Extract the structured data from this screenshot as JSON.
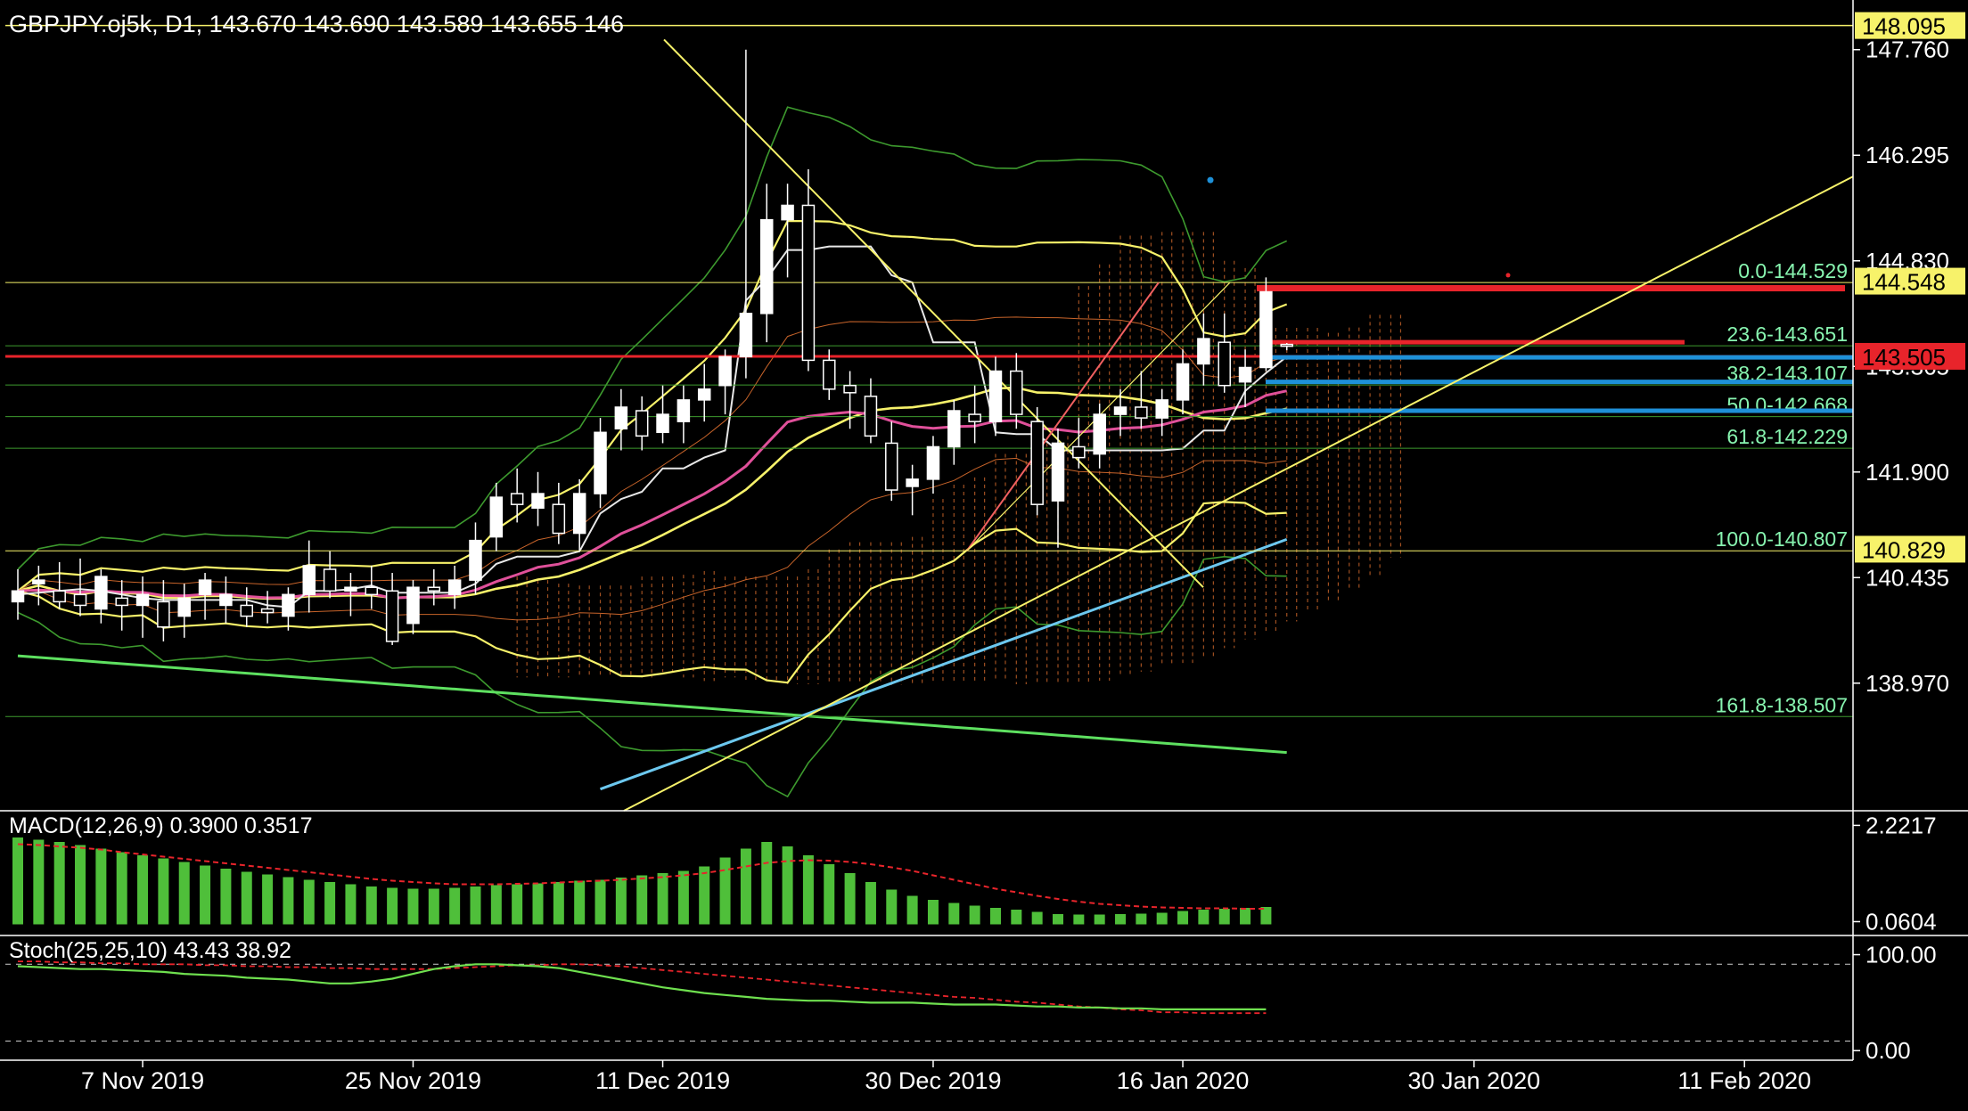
{
  "header": {
    "main_title": "GBPJPY.oj5k, D1, 143.670 143.690 143.589 143.655 146",
    "macd_title": "MACD(12,26,9) 0.3900 0.3517",
    "stoch_title": "Stoch(25,25,10) 43.43 38.92"
  },
  "colors": {
    "background": "#000000",
    "panel_border": "#ffffff",
    "candle": "#ffffff",
    "yellow": "#f7f26a",
    "red": "#e8242b",
    "blue": "#1e90d8",
    "fib_text": "#88f5b0",
    "macd_hist": "#4fbf3a",
    "macd_signal": "#e8242b",
    "stoch_main": "#6fe04f",
    "stoch_signal": "#e8242b",
    "ma_magenta": "#e0509a",
    "ma_green": "#5ee060",
    "ma_cyan": "#6cc8ef",
    "bb_green": "#3d9a2e",
    "ichimoku_cloud": "#c8642a"
  },
  "chart_data": [
    {
      "type": "candlestick",
      "symbol": "GBPJPY.oj5k",
      "timeframe": "D1",
      "ohlc_last": {
        "open": 143.67,
        "high": 143.69,
        "low": 143.589,
        "close": 143.655,
        "volume": 146
      },
      "y_ticks": [
        "147.760",
        "146.295",
        "144.830",
        "143.365",
        "141.900",
        "140.435",
        "138.970"
      ],
      "ylim": [
        137.2,
        148.35
      ],
      "x_ticks": [
        "7 Nov 2019",
        "25 Nov 2019",
        "11 Dec 2019",
        "30 Dec 2019",
        "16 Jan 2020",
        "30 Jan 2020",
        "11 Feb 2020"
      ],
      "x_tick_index": [
        6,
        19,
        31,
        44,
        56,
        70,
        83
      ],
      "candles": [
        {
          "o": 140.1,
          "h": 140.55,
          "l": 139.85,
          "c": 140.25
        },
        {
          "o": 140.35,
          "h": 140.6,
          "l": 140.05,
          "c": 140.4
        },
        {
          "o": 140.25,
          "h": 140.65,
          "l": 140.0,
          "c": 140.1
        },
        {
          "o": 140.2,
          "h": 140.7,
          "l": 139.9,
          "c": 140.05
        },
        {
          "o": 140.0,
          "h": 140.55,
          "l": 139.8,
          "c": 140.45
        },
        {
          "o": 140.15,
          "h": 140.4,
          "l": 139.7,
          "c": 140.05
        },
        {
          "o": 140.05,
          "h": 140.45,
          "l": 139.6,
          "c": 140.2
        },
        {
          "o": 140.1,
          "h": 140.4,
          "l": 139.55,
          "c": 139.75
        },
        {
          "o": 139.9,
          "h": 140.35,
          "l": 139.6,
          "c": 140.15
        },
        {
          "o": 140.2,
          "h": 140.5,
          "l": 139.85,
          "c": 140.4
        },
        {
          "o": 140.05,
          "h": 140.45,
          "l": 139.8,
          "c": 140.2
        },
        {
          "o": 140.05,
          "h": 140.3,
          "l": 139.75,
          "c": 139.9
        },
        {
          "o": 140.0,
          "h": 140.25,
          "l": 139.8,
          "c": 139.95
        },
        {
          "o": 139.9,
          "h": 140.3,
          "l": 139.7,
          "c": 140.2
        },
        {
          "o": 140.2,
          "h": 140.95,
          "l": 139.95,
          "c": 140.6
        },
        {
          "o": 140.55,
          "h": 140.8,
          "l": 140.15,
          "c": 140.25
        },
        {
          "o": 140.25,
          "h": 140.5,
          "l": 139.9,
          "c": 140.3
        },
        {
          "o": 140.3,
          "h": 140.6,
          "l": 140.0,
          "c": 140.2
        },
        {
          "o": 140.25,
          "h": 140.5,
          "l": 139.5,
          "c": 139.55
        },
        {
          "o": 139.8,
          "h": 140.4,
          "l": 139.65,
          "c": 140.3
        },
        {
          "o": 140.3,
          "h": 140.55,
          "l": 140.05,
          "c": 140.25
        },
        {
          "o": 140.2,
          "h": 140.6,
          "l": 140.0,
          "c": 140.4
        },
        {
          "o": 140.4,
          "h": 141.2,
          "l": 140.2,
          "c": 140.95
        },
        {
          "o": 141.0,
          "h": 141.75,
          "l": 140.8,
          "c": 141.55
        },
        {
          "o": 141.6,
          "h": 141.95,
          "l": 141.2,
          "c": 141.45
        },
        {
          "o": 141.4,
          "h": 141.9,
          "l": 141.15,
          "c": 141.6
        },
        {
          "o": 141.45,
          "h": 141.75,
          "l": 140.9,
          "c": 141.05
        },
        {
          "o": 141.05,
          "h": 141.8,
          "l": 140.8,
          "c": 141.6
        },
        {
          "o": 141.6,
          "h": 142.65,
          "l": 141.4,
          "c": 142.45
        },
        {
          "o": 142.5,
          "h": 143.05,
          "l": 142.2,
          "c": 142.8
        },
        {
          "o": 142.75,
          "h": 142.95,
          "l": 142.2,
          "c": 142.4
        },
        {
          "o": 142.45,
          "h": 143.1,
          "l": 142.3,
          "c": 142.7
        },
        {
          "o": 142.6,
          "h": 143.1,
          "l": 142.3,
          "c": 142.9
        },
        {
          "o": 142.9,
          "h": 143.4,
          "l": 142.6,
          "c": 143.05
        },
        {
          "o": 143.1,
          "h": 143.6,
          "l": 142.7,
          "c": 143.5
        },
        {
          "o": 143.5,
          "h": 147.76,
          "l": 143.2,
          "c": 144.1
        },
        {
          "o": 144.1,
          "h": 145.9,
          "l": 143.7,
          "c": 145.4
        },
        {
          "o": 145.4,
          "h": 145.9,
          "l": 144.6,
          "c": 145.6
        },
        {
          "o": 145.6,
          "h": 146.1,
          "l": 143.3,
          "c": 143.45
        },
        {
          "o": 143.45,
          "h": 143.6,
          "l": 142.9,
          "c": 143.05
        },
        {
          "o": 143.1,
          "h": 143.3,
          "l": 142.5,
          "c": 143.0
        },
        {
          "o": 142.95,
          "h": 143.2,
          "l": 142.3,
          "c": 142.4
        },
        {
          "o": 142.3,
          "h": 142.6,
          "l": 141.5,
          "c": 141.65
        },
        {
          "o": 141.7,
          "h": 142.0,
          "l": 141.3,
          "c": 141.8
        },
        {
          "o": 141.8,
          "h": 142.4,
          "l": 141.6,
          "c": 142.25
        },
        {
          "o": 142.25,
          "h": 142.9,
          "l": 142.0,
          "c": 142.75
        },
        {
          "o": 142.7,
          "h": 143.1,
          "l": 142.3,
          "c": 142.6
        },
        {
          "o": 142.6,
          "h": 143.5,
          "l": 142.4,
          "c": 143.3
        },
        {
          "o": 143.3,
          "h": 143.55,
          "l": 142.5,
          "c": 142.7
        },
        {
          "o": 142.6,
          "h": 142.8,
          "l": 141.3,
          "c": 141.45
        },
        {
          "o": 141.5,
          "h": 142.5,
          "l": 140.85,
          "c": 142.3
        },
        {
          "o": 142.25,
          "h": 142.65,
          "l": 141.95,
          "c": 142.1
        },
        {
          "o": 142.15,
          "h": 142.85,
          "l": 141.95,
          "c": 142.7
        },
        {
          "o": 142.7,
          "h": 143.05,
          "l": 142.4,
          "c": 142.8
        },
        {
          "o": 142.8,
          "h": 143.3,
          "l": 142.5,
          "c": 142.65
        },
        {
          "o": 142.65,
          "h": 143.05,
          "l": 142.4,
          "c": 142.9
        },
        {
          "o": 142.9,
          "h": 143.6,
          "l": 142.7,
          "c": 143.4
        },
        {
          "o": 143.4,
          "h": 144.1,
          "l": 143.1,
          "c": 143.75
        },
        {
          "o": 143.7,
          "h": 144.1,
          "l": 143.0,
          "c": 143.1
        },
        {
          "o": 143.15,
          "h": 143.6,
          "l": 142.8,
          "c": 143.35
        },
        {
          "o": 143.35,
          "h": 144.6,
          "l": 143.3,
          "c": 144.4
        },
        {
          "o": 143.67,
          "h": 143.69,
          "l": 143.589,
          "c": 143.655
        }
      ],
      "fibonacci": [
        {
          "label": "0.0-144.529",
          "price": 144.529
        },
        {
          "label": "23.6-143.651",
          "price": 143.651
        },
        {
          "label": "38.2-143.107",
          "price": 143.107
        },
        {
          "label": "50.0-142.668",
          "price": 142.668
        },
        {
          "label": "61.8-142.229",
          "price": 142.229
        },
        {
          "label": "100.0-140.807",
          "price": 140.807
        },
        {
          "label": "161.8-138.507",
          "price": 138.507
        }
      ],
      "price_boxes": [
        {
          "label": "148.095",
          "price": 148.095,
          "color": "#f7f26a"
        },
        {
          "label": "144.548",
          "price": 144.548,
          "color": "#f7f26a"
        },
        {
          "label": "143.505",
          "price": 143.505,
          "color": "#e8242b"
        },
        {
          "label": "140.829",
          "price": 140.829,
          "color": "#f7f26a"
        }
      ]
    },
    {
      "type": "bar",
      "name": "MACD(12,26,9)",
      "values_label": "0.3900 0.3517",
      "y_ticks": [
        "2.2217",
        "0.0604"
      ],
      "ylim": [
        -0.25,
        2.55
      ],
      "histogram": [
        1.95,
        1.9,
        1.85,
        1.78,
        1.7,
        1.62,
        1.55,
        1.48,
        1.4,
        1.32,
        1.25,
        1.18,
        1.12,
        1.06,
        1.0,
        0.95,
        0.9,
        0.85,
        0.82,
        0.8,
        0.8,
        0.82,
        0.85,
        0.88,
        0.9,
        0.92,
        0.95,
        0.98,
        1.0,
        1.05,
        1.1,
        1.15,
        1.2,
        1.3,
        1.5,
        1.7,
        1.85,
        1.75,
        1.55,
        1.35,
        1.15,
        0.95,
        0.78,
        0.64,
        0.55,
        0.48,
        0.42,
        0.37,
        0.33,
        0.28,
        0.23,
        0.22,
        0.22,
        0.23,
        0.24,
        0.26,
        0.3,
        0.33,
        0.35,
        0.37,
        0.39
      ],
      "signal": [
        1.8,
        1.78,
        1.75,
        1.72,
        1.68,
        1.62,
        1.57,
        1.52,
        1.47,
        1.42,
        1.37,
        1.32,
        1.27,
        1.22,
        1.17,
        1.12,
        1.07,
        1.02,
        0.98,
        0.95,
        0.92,
        0.9,
        0.9,
        0.9,
        0.91,
        0.92,
        0.94,
        0.96,
        0.98,
        1.0,
        1.03,
        1.06,
        1.1,
        1.15,
        1.22,
        1.3,
        1.38,
        1.42,
        1.44,
        1.43,
        1.4,
        1.35,
        1.28,
        1.2,
        1.1,
        1.0,
        0.9,
        0.8,
        0.72,
        0.64,
        0.57,
        0.51,
        0.46,
        0.43,
        0.4,
        0.38,
        0.37,
        0.36,
        0.36,
        0.35,
        0.35
      ]
    },
    {
      "type": "line",
      "name": "Stoch(25,25,10)",
      "values_label": "43.43 38.92",
      "y_ticks": [
        "100.00",
        "0.00"
      ],
      "ylim": [
        -10,
        120
      ],
      "levels": [
        90,
        10
      ],
      "main": [
        88,
        87,
        86,
        85,
        85,
        84,
        83,
        82,
        80,
        79,
        78,
        76,
        75,
        74,
        72,
        70,
        70,
        72,
        75,
        80,
        85,
        88,
        90,
        90,
        89,
        88,
        86,
        82,
        78,
        74,
        70,
        66,
        63,
        60,
        58,
        56,
        54,
        53,
        52,
        52,
        51,
        50,
        50,
        50,
        49,
        48,
        48,
        48,
        47,
        46,
        46,
        45,
        45,
        44,
        44,
        43,
        43,
        43,
        43,
        43,
        43
      ],
      "signal": [
        93,
        93,
        92,
        92,
        91,
        91,
        90,
        90,
        90,
        89,
        89,
        88,
        88,
        87,
        87,
        86,
        86,
        85,
        85,
        85,
        85,
        86,
        87,
        88,
        89,
        89,
        90,
        90,
        89,
        88,
        86,
        84,
        82,
        80,
        78,
        76,
        74,
        72,
        70,
        68,
        66,
        64,
        62,
        60,
        58,
        56,
        55,
        53,
        51,
        50,
        48,
        46,
        45,
        43,
        42,
        40,
        40,
        39,
        39,
        39,
        39
      ]
    }
  ]
}
